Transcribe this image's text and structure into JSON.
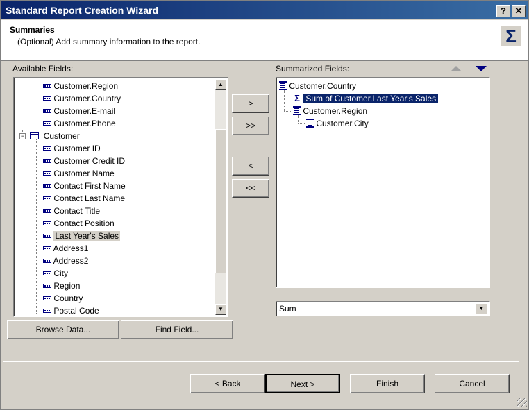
{
  "window": {
    "title": "Standard Report Creation Wizard"
  },
  "titlebar_buttons": {
    "help": "?",
    "close": "✕"
  },
  "header": {
    "title": "Summaries",
    "description": "(Optional) Add summary information to the report.",
    "icon": "Σ"
  },
  "available": {
    "label": "Available Fields:",
    "items": [
      "Customer.Region",
      "Customer.Country",
      "Customer.E-mail",
      "Customer.Phone",
      "Customer",
      "Customer ID",
      "Customer Credit ID",
      "Customer Name",
      "Contact First Name",
      "Contact Last Name",
      "Contact Title",
      "Contact Position",
      "Last Year's Sales",
      "Address1",
      "Address2",
      "City",
      "Region",
      "Country",
      "Postal Code"
    ],
    "expander": "−"
  },
  "summarized": {
    "label": "Summarized Fields:",
    "items": [
      "Customer.Country",
      "Sum of Customer.Last Year's Sales",
      "Customer.Region",
      "Customer.City"
    ],
    "summary_select": "Sum"
  },
  "transfer_buttons": {
    "add": ">",
    "add_all": ">>",
    "remove": "<",
    "remove_all": "<<"
  },
  "bottom_buttons": {
    "browse": "Browse Data...",
    "find": "Find Field..."
  },
  "nav": {
    "back": "< Back",
    "next": "Next >",
    "finish": "Finish",
    "cancel": "Cancel"
  },
  "icons": {
    "up": "up-arrow-icon",
    "down": "down-arrow-icon"
  },
  "colors": {
    "title_bar": "#0a246a",
    "selection": "#0a246a",
    "dialog_bg": "#d4d0c8"
  }
}
